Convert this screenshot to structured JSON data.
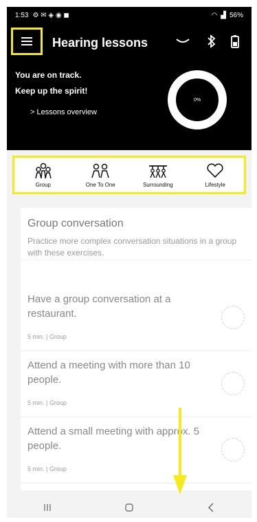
{
  "status_bar": {
    "time": "1:53",
    "battery": "56%"
  },
  "app_bar": {
    "title": "Hearing lessons"
  },
  "progress": {
    "line1": "You are on track.",
    "line2": "Keep up the spirit!",
    "overview_link": "> Lessons overview",
    "percent_label": "0%",
    "percent": 0
  },
  "tabs": [
    {
      "label": "Group",
      "icon": "group-icon"
    },
    {
      "label": "One To One",
      "icon": "one-to-one-icon"
    },
    {
      "label": "Surrounding",
      "icon": "surrounding-icon"
    },
    {
      "label": "Lifestyle",
      "icon": "heart-icon"
    }
  ],
  "section": {
    "title": "Group conversation",
    "description": "Practice more complex conversation situations in a group with these exercises."
  },
  "lessons": [
    {
      "title": "Have a group conversation at a restaurant.",
      "meta": "5 min. | Group"
    },
    {
      "title": "Attend a meeting with more than 10 people.",
      "meta": "5 min. | Group"
    },
    {
      "title": "Attend a small meeting with approx. 5 people.",
      "meta": "5 min. | Group"
    }
  ],
  "colors": {
    "highlight": "#f4ea1e",
    "header_bg": "#000000"
  }
}
